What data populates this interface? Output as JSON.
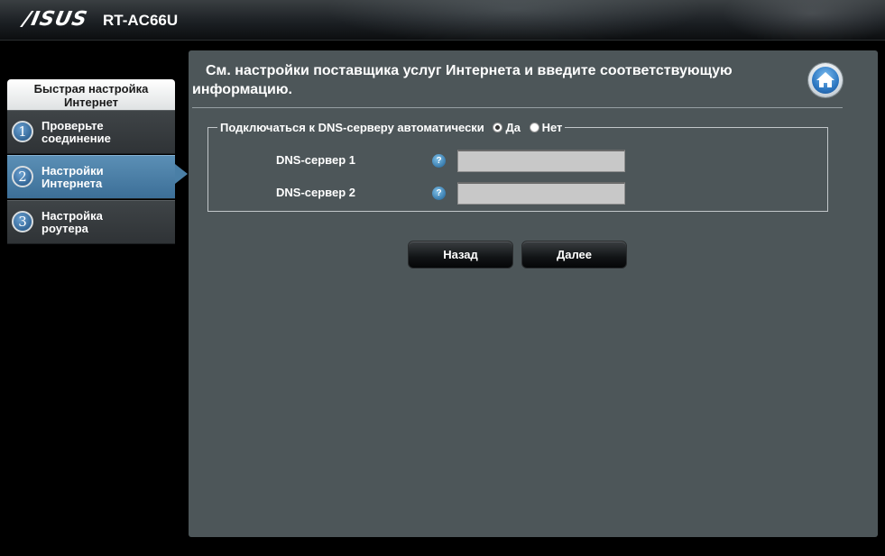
{
  "header": {
    "brand": "/ISUS",
    "model": "RT-AC66U"
  },
  "sidebar": {
    "title_line1": "Быстрая настройка",
    "title_line2": "Интернет",
    "steps": [
      {
        "number": "1",
        "line1": "Проверьте",
        "line2": "соединение",
        "active": false
      },
      {
        "number": "2",
        "line1": "Настройки",
        "line2": "Интернета",
        "active": true
      },
      {
        "number": "3",
        "line1": "Настройка",
        "line2": "роутера",
        "active": false
      }
    ]
  },
  "main": {
    "title": "См. настройки поставщика услуг Интернета и введите соответствующую информацию.",
    "home_icon": "home-icon",
    "dns_auto": {
      "label": "Подключаться к DNS-серверу автоматически",
      "options": [
        {
          "label": "Да",
          "selected": true
        },
        {
          "label": "Нет",
          "selected": false
        }
      ]
    },
    "dns1": {
      "label": "DNS-сервер 1",
      "help": "?",
      "value": ""
    },
    "dns2": {
      "label": "DNS-сервер 2",
      "help": "?",
      "value": ""
    },
    "buttons": {
      "back": "Назад",
      "next": "Далее"
    }
  },
  "colors": {
    "panel_bg": "#4d5659",
    "active_step": "#4a7fa6",
    "input_bg": "#c8c8c8"
  }
}
